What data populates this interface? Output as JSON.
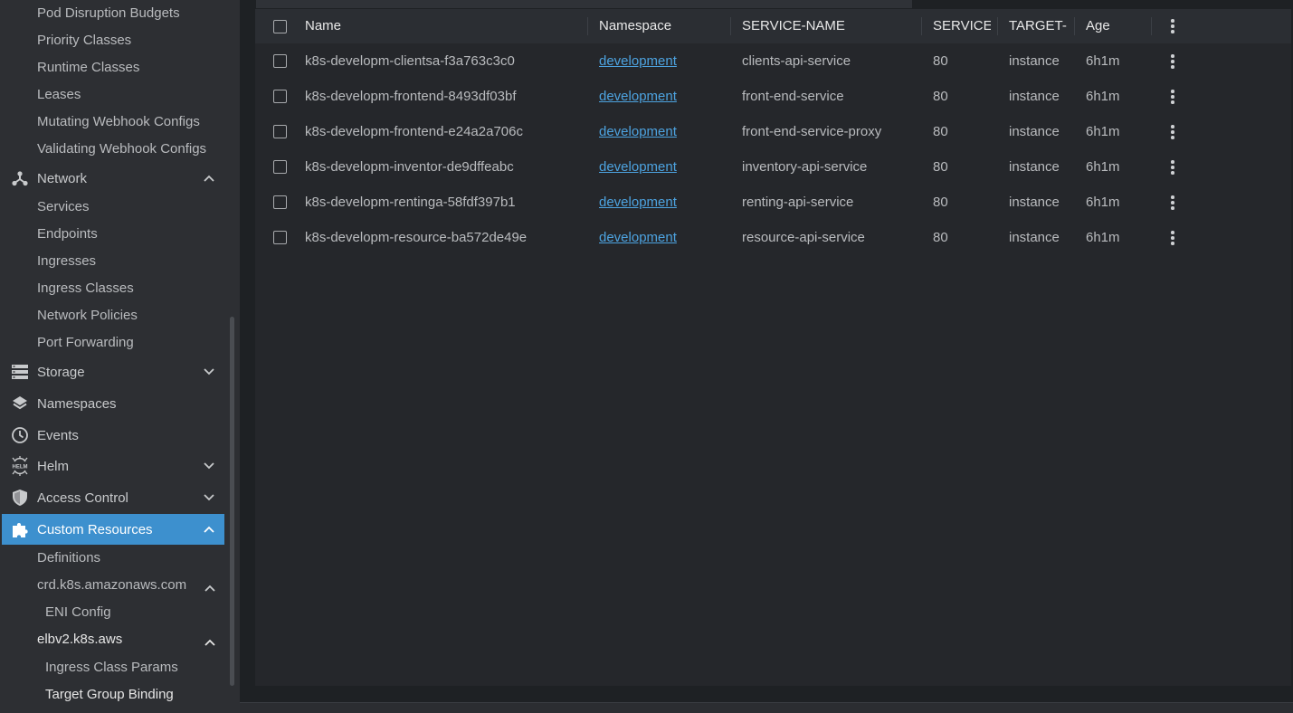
{
  "sidebar": {
    "top_items": [
      "Pod Disruption Budgets",
      "Priority Classes",
      "Runtime Classes",
      "Leases",
      "Mutating Webhook Configs",
      "Validating Webhook Configs"
    ],
    "network": {
      "label": "Network",
      "items": [
        "Services",
        "Endpoints",
        "Ingresses",
        "Ingress Classes",
        "Network Policies",
        "Port Forwarding"
      ]
    },
    "storage": {
      "label": "Storage"
    },
    "namespaces": {
      "label": "Namespaces"
    },
    "events": {
      "label": "Events"
    },
    "helm": {
      "label": "Helm",
      "icon_text": "HELM"
    },
    "access_control": {
      "label": "Access Control"
    },
    "custom_resources": {
      "label": "Custom Resources",
      "definitions": "Definitions",
      "group1": {
        "label": "crd.k8s.amazonaws.com",
        "items": [
          "ENI Config"
        ]
      },
      "group2": {
        "label": "elbv2.k8s.aws",
        "items": [
          "Ingress Class Params",
          "Target Group Binding"
        ]
      }
    }
  },
  "table": {
    "columns": [
      "Name",
      "Namespace",
      "SERVICE-NAME",
      "SERVICE-I",
      "TARGET-T",
      "Age"
    ],
    "rows": [
      {
        "name": "k8s-developm-clientsa-f3a763c3c0",
        "namespace": "development",
        "service_name": "clients-api-service",
        "service_port": "80",
        "target_type": "instance",
        "age": "6h1m"
      },
      {
        "name": "k8s-developm-frontend-8493df03bf",
        "namespace": "development",
        "service_name": "front-end-service",
        "service_port": "80",
        "target_type": "instance",
        "age": "6h1m"
      },
      {
        "name": "k8s-developm-frontend-e24a2a706c",
        "namespace": "development",
        "service_name": "front-end-service-proxy",
        "service_port": "80",
        "target_type": "instance",
        "age": "6h1m"
      },
      {
        "name": "k8s-developm-inventor-de9dffeabc",
        "namespace": "development",
        "service_name": "inventory-api-service",
        "service_port": "80",
        "target_type": "instance",
        "age": "6h1m"
      },
      {
        "name": "k8s-developm-rentinga-58fdf397b1",
        "namespace": "development",
        "service_name": "renting-api-service",
        "service_port": "80",
        "target_type": "instance",
        "age": "6h1m"
      },
      {
        "name": "k8s-developm-resource-ba572de49e",
        "namespace": "development",
        "service_name": "resource-api-service",
        "service_port": "80",
        "target_type": "instance",
        "age": "6h1m"
      }
    ]
  },
  "colors": {
    "active_item": "#3d90ce",
    "link": "#4da3e0",
    "sidebar_bg": "#2d2f33",
    "panel_bg": "#25272b"
  }
}
